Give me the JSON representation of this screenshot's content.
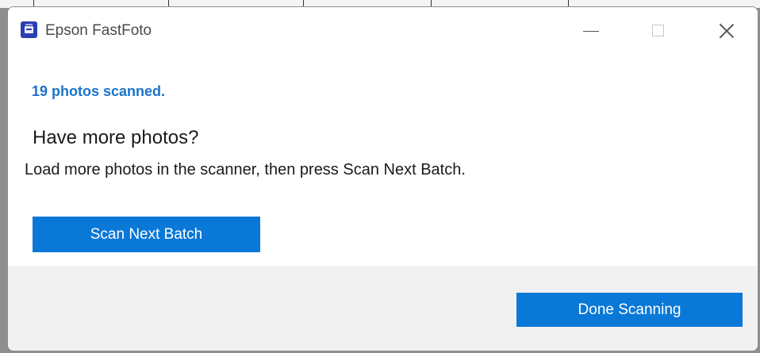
{
  "window": {
    "title": "Epson FastFoto",
    "app_icon": "scanner-icon",
    "controls": [
      "minimize-icon",
      "maximize-icon",
      "close-icon"
    ]
  },
  "main": {
    "status": "19 photos scanned.",
    "heading": "Have more photos?",
    "instruction": "Load more photos in the scanner, then press Scan Next Batch.",
    "scan_next_label": "Scan Next Batch"
  },
  "footer": {
    "done_label": "Done Scanning"
  },
  "colors": {
    "accent": "#0a78d7",
    "status_text": "#1a73c8",
    "footer_bg": "#f1f1f1"
  }
}
